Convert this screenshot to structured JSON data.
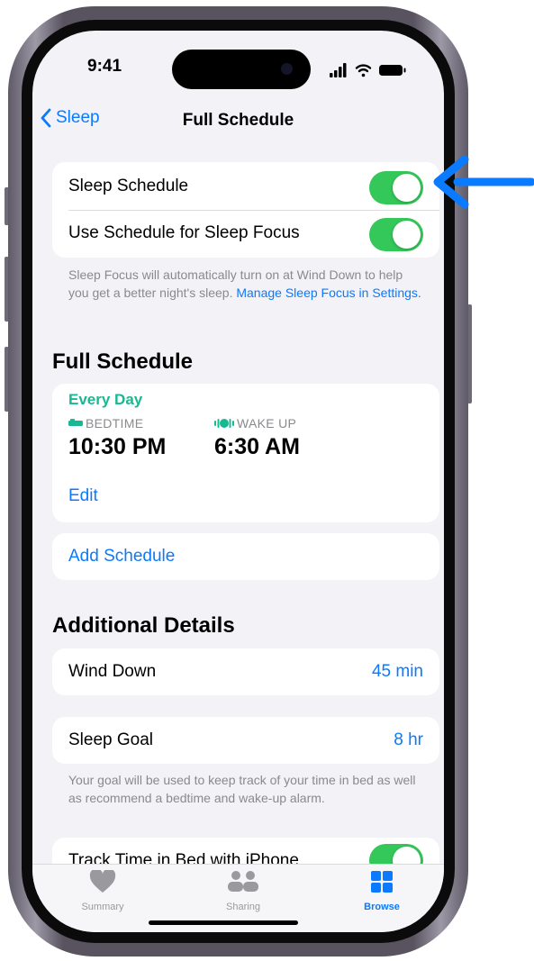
{
  "status_bar": {
    "time": "9:41"
  },
  "nav": {
    "back_label": "Sleep",
    "title": "Full Schedule"
  },
  "settings_card": {
    "sleep_schedule_label": "Sleep Schedule",
    "sleep_schedule_on": true,
    "sleep_focus_label": "Use Schedule for Sleep Focus",
    "sleep_focus_on": true
  },
  "focus_footnote": {
    "text": "Sleep Focus will automatically turn on at Wind Down to help you get a better night's sleep.",
    "link": "Manage Sleep Focus in Settings."
  },
  "full_schedule": {
    "header": "Full Schedule",
    "day": "Every Day",
    "bedtime_label": "BEDTIME",
    "bedtime": "10:30 PM",
    "wakeup_label": "WAKE UP",
    "wakeup": "6:30 AM",
    "edit": "Edit",
    "add_schedule": "Add Schedule"
  },
  "additional": {
    "header": "Additional Details",
    "wind_down_label": "Wind Down",
    "wind_down_value": "45 min",
    "sleep_goal_label": "Sleep Goal",
    "sleep_goal_value": "8 hr",
    "goal_footnote": "Your goal will be used to keep track of your time in bed as well as recommend a bedtime and wake-up alarm.",
    "track_label": "Track Time in Bed with iPhone",
    "track_on": true
  },
  "tabs": [
    {
      "label": "Summary",
      "icon": "heart-icon",
      "active": false
    },
    {
      "label": "Sharing",
      "icon": "people-icon",
      "active": false
    },
    {
      "label": "Browse",
      "icon": "grid-icon",
      "active": true
    }
  ],
  "colors": {
    "accent": "#0a7aff",
    "toggle_on": "#34c759",
    "schedule_green": "#19b893",
    "annotation_arrow": "#0a7aff"
  }
}
